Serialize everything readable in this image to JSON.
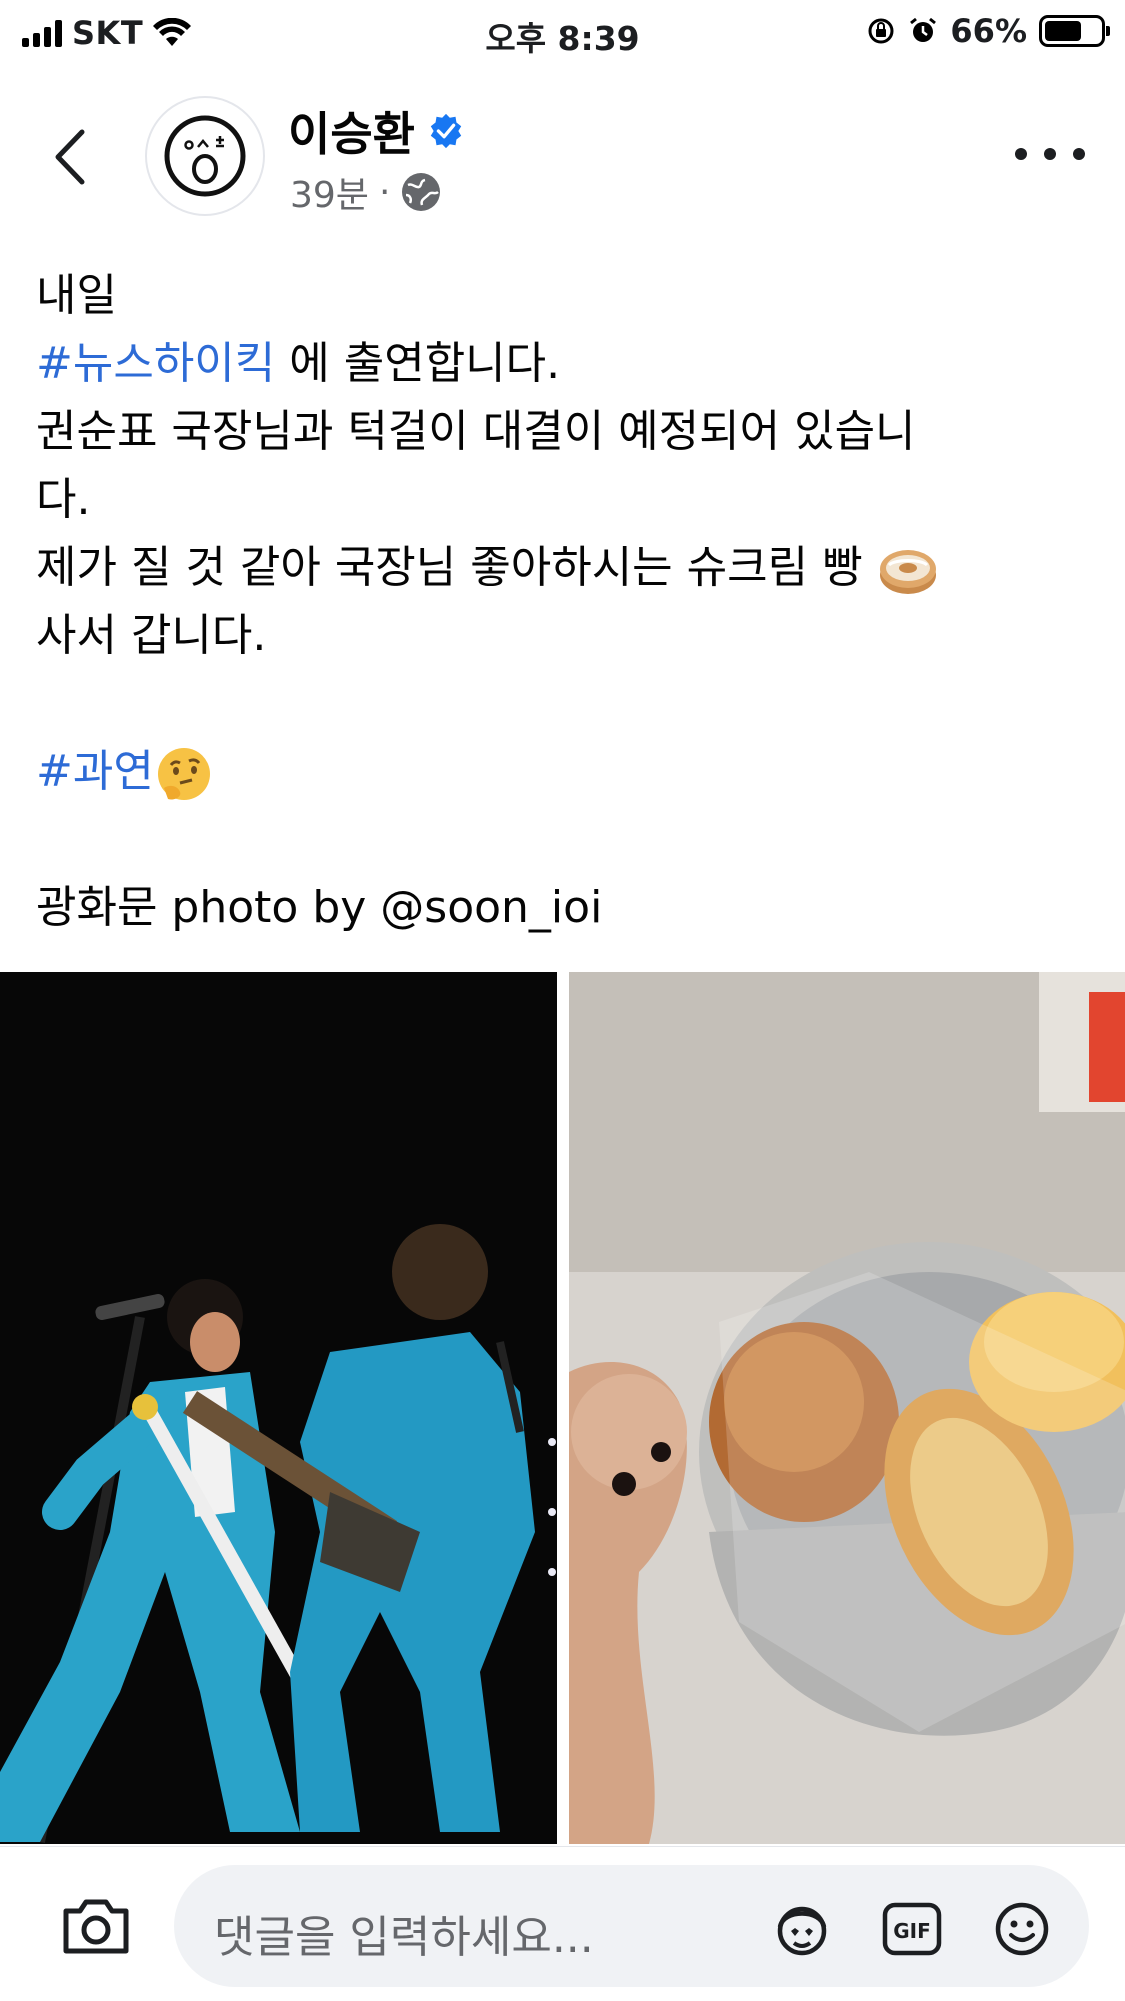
{
  "status_bar": {
    "carrier": "SKT",
    "time": "오후 8:39",
    "battery_percent": "66%",
    "battery_level": 0.66
  },
  "post": {
    "author": "이승환",
    "verified": true,
    "time_ago": "39분",
    "separator": "·",
    "audience_icon": "globe-icon",
    "text": {
      "line1": "내일",
      "line2_hashtag": "#뉴스하이킥",
      "line2_rest": " 에 출연합니다.",
      "line3": "권순표 국장님과 턱걸이 대결이 예정되어 있습니",
      "line4": "다.",
      "line5": "제가 질 것 같아 국장님 좋아하시는 슈크림 빵 ",
      "line5_emoji": "bagel-emoji",
      "line6": "사서 갑니다.",
      "line7_hashtag": "#과연",
      "line7_emoji": "thinking-face-emoji",
      "line8": "광화문 photo by @soon_ioi"
    },
    "photos": [
      {
        "name": "concert-photo"
      },
      {
        "name": "bread-photo"
      }
    ]
  },
  "comment_bar": {
    "placeholder": "댓글을 입력하세요...",
    "icons": [
      "camera-icon",
      "avatar-sticker-icon",
      "gif-icon",
      "smiley-icon"
    ]
  },
  "colors": {
    "hashtag": "#2d6bd6",
    "verified": "#1877f2",
    "meta": "#65676b",
    "input_bg": "#f0f2f5"
  }
}
